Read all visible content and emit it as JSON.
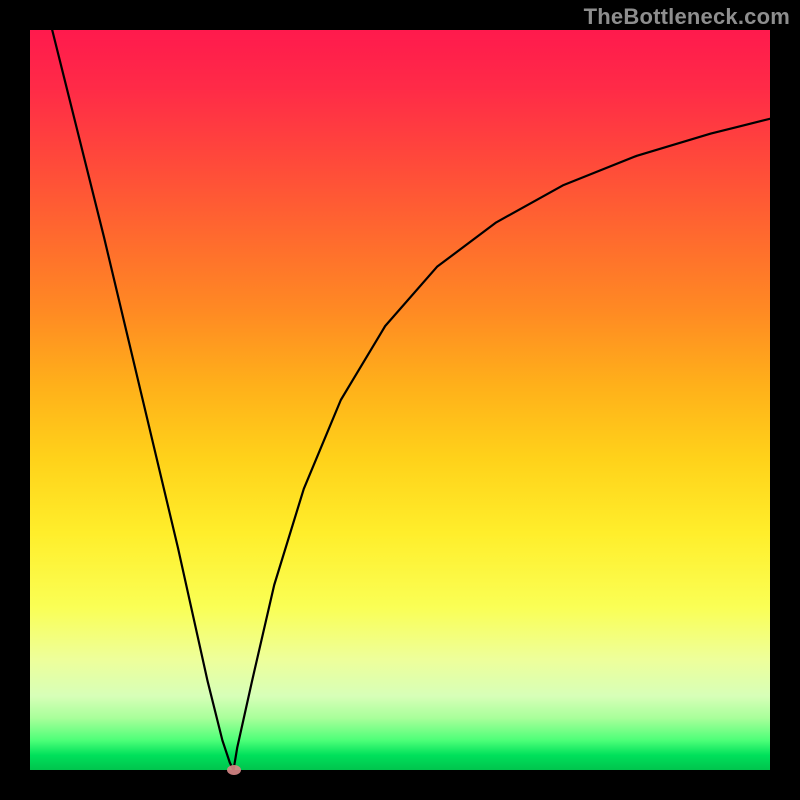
{
  "watermark": "TheBottleneck.com",
  "colors": {
    "frame": "#000000",
    "curve": "#000000",
    "marker": "#d98787",
    "gradient_top": "#ff1a4d",
    "gradient_bottom": "#00c44d"
  },
  "chart_data": {
    "type": "line",
    "title": "",
    "xlabel": "",
    "ylabel": "",
    "xlim": [
      0,
      100
    ],
    "ylim": [
      0,
      100
    ],
    "grid": false,
    "legend": false,
    "series": [
      {
        "name": "left-branch",
        "x": [
          3,
          5,
          10,
          15,
          20,
          24,
          26,
          27,
          27.5
        ],
        "y": [
          100,
          92,
          72,
          51,
          30,
          12,
          4,
          1,
          0
        ]
      },
      {
        "name": "right-branch",
        "x": [
          27.5,
          28,
          30,
          33,
          37,
          42,
          48,
          55,
          63,
          72,
          82,
          92,
          100
        ],
        "y": [
          0,
          3,
          12,
          25,
          38,
          50,
          60,
          68,
          74,
          79,
          83,
          86,
          88
        ]
      }
    ],
    "marker": {
      "x": 27.5,
      "y": 0
    }
  }
}
